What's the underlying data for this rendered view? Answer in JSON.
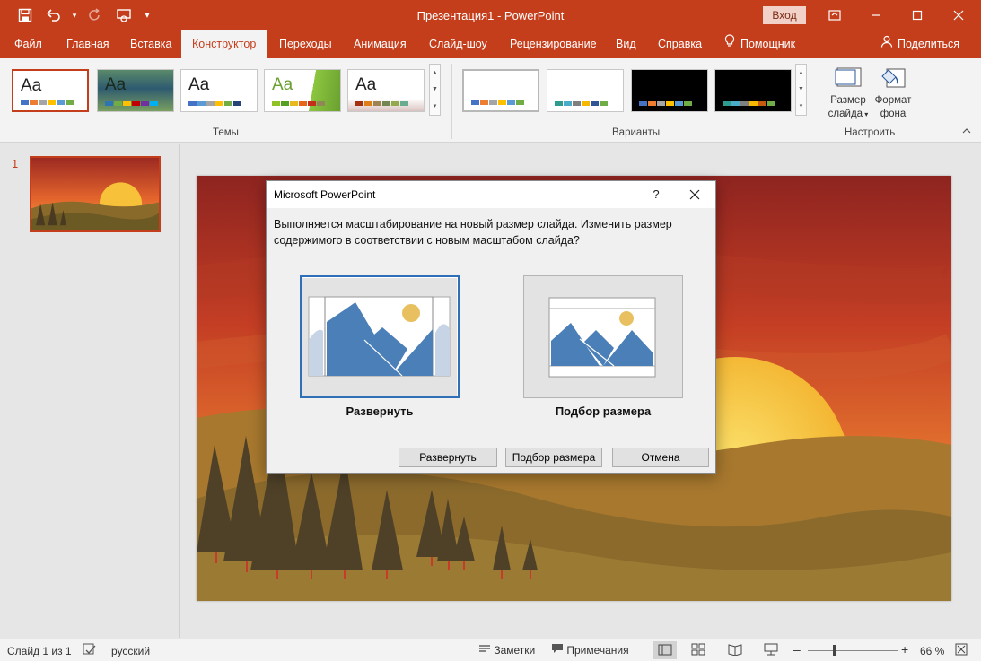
{
  "window": {
    "title": "Презентация1  -  PowerPoint",
    "signin_label": "Вход"
  },
  "quick_access": {
    "save_icon": "save-icon",
    "undo_icon": "undo-icon",
    "redo_icon": "redo-icon",
    "present_icon": "present-from-start-icon",
    "customize_icon": "customize-qat-icon"
  },
  "ribbon_tabs": [
    {
      "label": "Файл"
    },
    {
      "label": "Главная"
    },
    {
      "label": "Вставка"
    },
    {
      "label": "Конструктор"
    },
    {
      "label": "Переходы"
    },
    {
      "label": "Анимация"
    },
    {
      "label": "Слайд-шоу"
    },
    {
      "label": "Рецензирование"
    },
    {
      "label": "Вид"
    },
    {
      "label": "Справка"
    },
    {
      "label": "Помощник"
    }
  ],
  "share_label": "Поделиться",
  "ribbon": {
    "themes_group_label": "Темы",
    "variants_group_label": "Варианты",
    "customize_group_label": "Настроить",
    "themes": [
      {
        "text": "Aa"
      },
      {
        "text": "Aa"
      },
      {
        "text": "Aa"
      },
      {
        "text": "Aa"
      },
      {
        "text": "Aa"
      }
    ],
    "slide_size_line1": "Размер",
    "slide_size_line2": "слайда",
    "format_bg_line1": "Формат",
    "format_bg_line2": "фона"
  },
  "slides_panel": {
    "slide_number": "1"
  },
  "dialog": {
    "title": "Microsoft PowerPoint",
    "help": "?",
    "message": "Выполняется масштабирование на новый размер слайда. Изменить размер содержимого в соответствии с новым масштабом слайда?",
    "option_maximize_label": "Развернуть",
    "option_fit_label": "Подбор размера",
    "button_maximize": "Развернуть",
    "button_fit": "Подбор размера",
    "button_cancel": "Отмена"
  },
  "status_bar": {
    "slide_info": "Слайд 1 из 1",
    "language": "русский",
    "notes_label": "Заметки",
    "comments_label": "Примечания",
    "zoom_percent": "66 %",
    "zoom_level": 0.66
  },
  "colors": {
    "accent": "#c43e1c",
    "dialog_focus": "#2f6fb8"
  }
}
